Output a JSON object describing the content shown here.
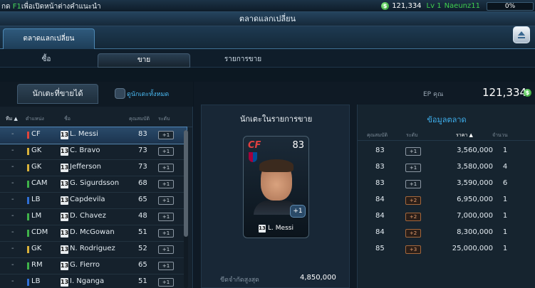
{
  "topbar": {
    "hint_key_prefix": "กด",
    "hint_key": "F1",
    "hint_text": "เพื่อเปิดหน้าต่างคำแนะนำ",
    "balance": "121,334",
    "level": "Lv 1",
    "username": "Naeunz11",
    "progress_label": "0%",
    "progress_fraction": 0
  },
  "window_title": "ตลาดแลกเปลี่ยน",
  "main_tab": "ตลาดแลกเปลี่ยน",
  "subtabs": {
    "buy": "ซื้อ",
    "sell": "ขาย",
    "sale_list": "รายการขาย"
  },
  "left_panel": {
    "tab_label": "นักเตะที่ขายได้",
    "check_all": "ดูนักเตะทั้งหมด",
    "columns": {
      "team": "ทีม ▲",
      "position": "ตำแหน่ง",
      "name": "ชื่อ",
      "ovr": "คุณสมบัติ",
      "level": "ระดับ"
    },
    "players": [
      {
        "team": "-",
        "pos": "CF",
        "pos_color": "#e0453b",
        "season": "13",
        "name": "L. Messi",
        "ovr": "83",
        "level": "+1"
      },
      {
        "team": "-",
        "pos": "GK",
        "pos_color": "#d9b23a",
        "season": "13",
        "name": "C. Bravo",
        "ovr": "73",
        "level": "+1"
      },
      {
        "team": "-",
        "pos": "GK",
        "pos_color": "#d9b23a",
        "season": "13",
        "name": "Jefferson",
        "ovr": "73",
        "level": "+1"
      },
      {
        "team": "-",
        "pos": "CAM",
        "pos_color": "#3fb24a",
        "season": "13",
        "name": "G. Sigurdsson",
        "ovr": "68",
        "level": "+1"
      },
      {
        "team": "-",
        "pos": "LB",
        "pos_color": "#2f6fd6",
        "season": "13",
        "name": "Capdevila",
        "ovr": "65",
        "level": "+1"
      },
      {
        "team": "-",
        "pos": "LM",
        "pos_color": "#3fb24a",
        "season": "13",
        "name": "D. Chavez",
        "ovr": "48",
        "level": "+1"
      },
      {
        "team": "-",
        "pos": "CDM",
        "pos_color": "#3fb24a",
        "season": "13",
        "name": "D. McGowan",
        "ovr": "51",
        "level": "+1"
      },
      {
        "team": "-",
        "pos": "GK",
        "pos_color": "#d9b23a",
        "season": "13",
        "name": "N. Rodriguez",
        "ovr": "52",
        "level": "+1"
      },
      {
        "team": "-",
        "pos": "RM",
        "pos_color": "#3fb24a",
        "season": "13",
        "name": "G. Fierro",
        "ovr": "65",
        "level": "+1"
      },
      {
        "team": "-",
        "pos": "LB",
        "pos_color": "#2f6fd6",
        "season": "13",
        "name": "I. Nganga",
        "ovr": "51",
        "level": "+1"
      }
    ]
  },
  "ep": {
    "label": "EP คุณ",
    "value": "121,334"
  },
  "sale_panel": {
    "title": "นักเตะในรายการขาย",
    "card": {
      "pos": "CF",
      "ovr": "83",
      "plus": "+1",
      "season": "13",
      "name": "L. Messi"
    },
    "max_price_label": "ขีดจำกัดสูงสุด",
    "max_price": "4,850,000"
  },
  "market_panel": {
    "title": "ข้อมูลตลาด",
    "columns": {
      "ovr": "คุณสมบัติ",
      "level": "ระดับ",
      "price": "ราคา ▲",
      "count": "จำนวน"
    },
    "rows": [
      {
        "ovr": "83",
        "level": "+1",
        "price": "3,560,000",
        "count": "1"
      },
      {
        "ovr": "83",
        "level": "+1",
        "price": "3,580,000",
        "count": "4"
      },
      {
        "ovr": "83",
        "level": "+1",
        "price": "3,590,000",
        "count": "6"
      },
      {
        "ovr": "84",
        "level": "+2",
        "price": "6,950,000",
        "count": "1"
      },
      {
        "ovr": "84",
        "level": "+2",
        "price": "7,000,000",
        "count": "1"
      },
      {
        "ovr": "84",
        "level": "+2",
        "price": "8,300,000",
        "count": "1"
      },
      {
        "ovr": "85",
        "level": "+3",
        "price": "25,000,000",
        "count": "1"
      }
    ]
  }
}
